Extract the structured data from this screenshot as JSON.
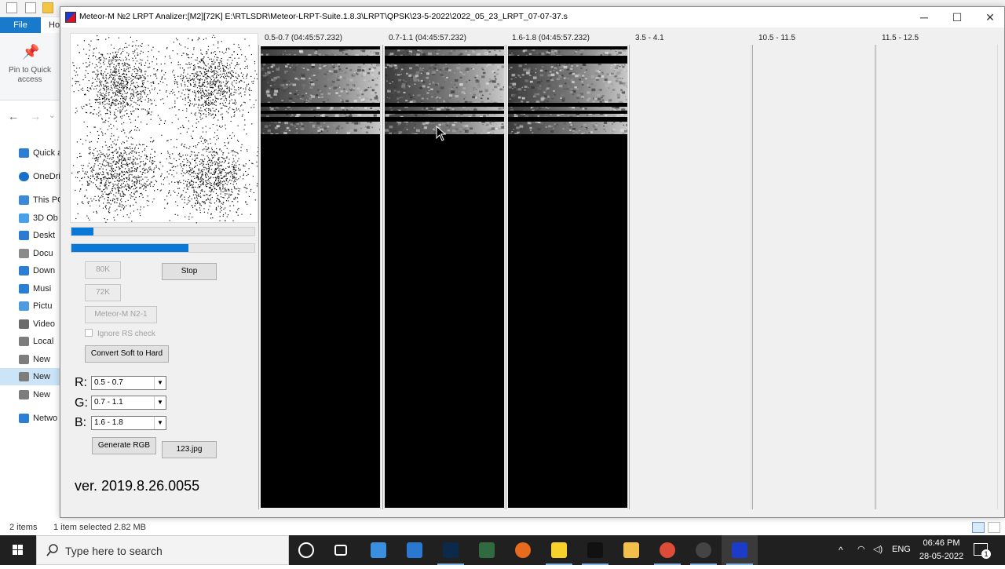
{
  "explorer": {
    "ribbon": {
      "file_tab": "File",
      "home_tab": "Ho"
    },
    "quick_access_pin": "Pin to Quick access",
    "nav_items": [
      {
        "label": "Quick a",
        "icon": "star-icon"
      },
      {
        "label": "OneDri",
        "icon": "cloud-icon"
      },
      {
        "label": "This PC",
        "icon": "computer-icon"
      },
      {
        "label": "3D Ob",
        "icon": "cube-icon"
      },
      {
        "label": "Deskt",
        "icon": "desktop-icon"
      },
      {
        "label": "Docu",
        "icon": "document-icon"
      },
      {
        "label": "Down",
        "icon": "download-icon"
      },
      {
        "label": "Musi",
        "icon": "music-icon"
      },
      {
        "label": "Pictu",
        "icon": "picture-icon"
      },
      {
        "label": "Video",
        "icon": "video-icon"
      },
      {
        "label": "Local",
        "icon": "drive-icon"
      },
      {
        "label": "New",
        "icon": "drive-icon"
      },
      {
        "label": "New",
        "icon": "drive-icon",
        "selected": true
      },
      {
        "label": "New",
        "icon": "drive-icon"
      },
      {
        "label": "Netwo",
        "icon": "network-icon"
      }
    ],
    "status": {
      "items": "2 items",
      "selected": "1 item selected  2.82 MB"
    }
  },
  "window": {
    "title": "Meteor-M №2 LRPT Analizer:[M2][72K] E:\\RTLSDR\\Meteor-LRPT-Suite.1.8.3\\LRPT\\QPSK\\23-5-2022\\2022_05_23_LRPT_07-07-37.s",
    "controls": {
      "minimize": "─",
      "maximize": "☐",
      "close": "✕"
    }
  },
  "analyzer": {
    "progress": [
      0.12,
      0.64
    ],
    "buttons": {
      "k80": "80K",
      "stop": "Stop",
      "k72": "72K",
      "meteor": "Meteor-M N2-1",
      "convert": "Convert Soft to Hard",
      "generate": "Generate RGB",
      "jpg": "123.jpg"
    },
    "ignore_rs": {
      "label": "Ignore RS check",
      "checked": false
    },
    "channel_select": {
      "r_label": "R:",
      "r_value": "0.5 - 0.7",
      "g_label": "G:",
      "g_value": "0.7 - 1.1",
      "b_label": "B:",
      "b_value": "1.6 - 1.8"
    },
    "version": "ver. 2019.8.26.0055",
    "channels": [
      {
        "title": "0.5-0.7 (04:45:57.232)",
        "has_image": true
      },
      {
        "title": "0.7-1.1 (04:45:57.232)",
        "has_image": true
      },
      {
        "title": "1.6-1.8 (04:45:57.232)",
        "has_image": true
      },
      {
        "title": "3.5 - 4.1",
        "has_image": false
      },
      {
        "title": "10.5 - 11.5",
        "has_image": false
      },
      {
        "title": "11.5 - 12.5",
        "has_image": false
      }
    ]
  },
  "taskbar": {
    "search_placeholder": "Type here to search",
    "apps": [
      "cortana-icon",
      "task-view-icon",
      "store-icon",
      "mail-icon",
      "photoshop-icon",
      "app-icon",
      "firefox-icon",
      "sticky-notes-icon",
      "terminal-icon",
      "file-explorer-icon",
      "chrome-icon",
      "clock-app-icon",
      "analyzer-icon"
    ],
    "tray": {
      "language": "ENG",
      "time": "06:46 PM",
      "date": "28-05-2022",
      "notifications": "1"
    }
  },
  "colors": {
    "accent": "#0a78d7",
    "taskbar": "#202020",
    "window_bg": "#f0f0f0"
  }
}
